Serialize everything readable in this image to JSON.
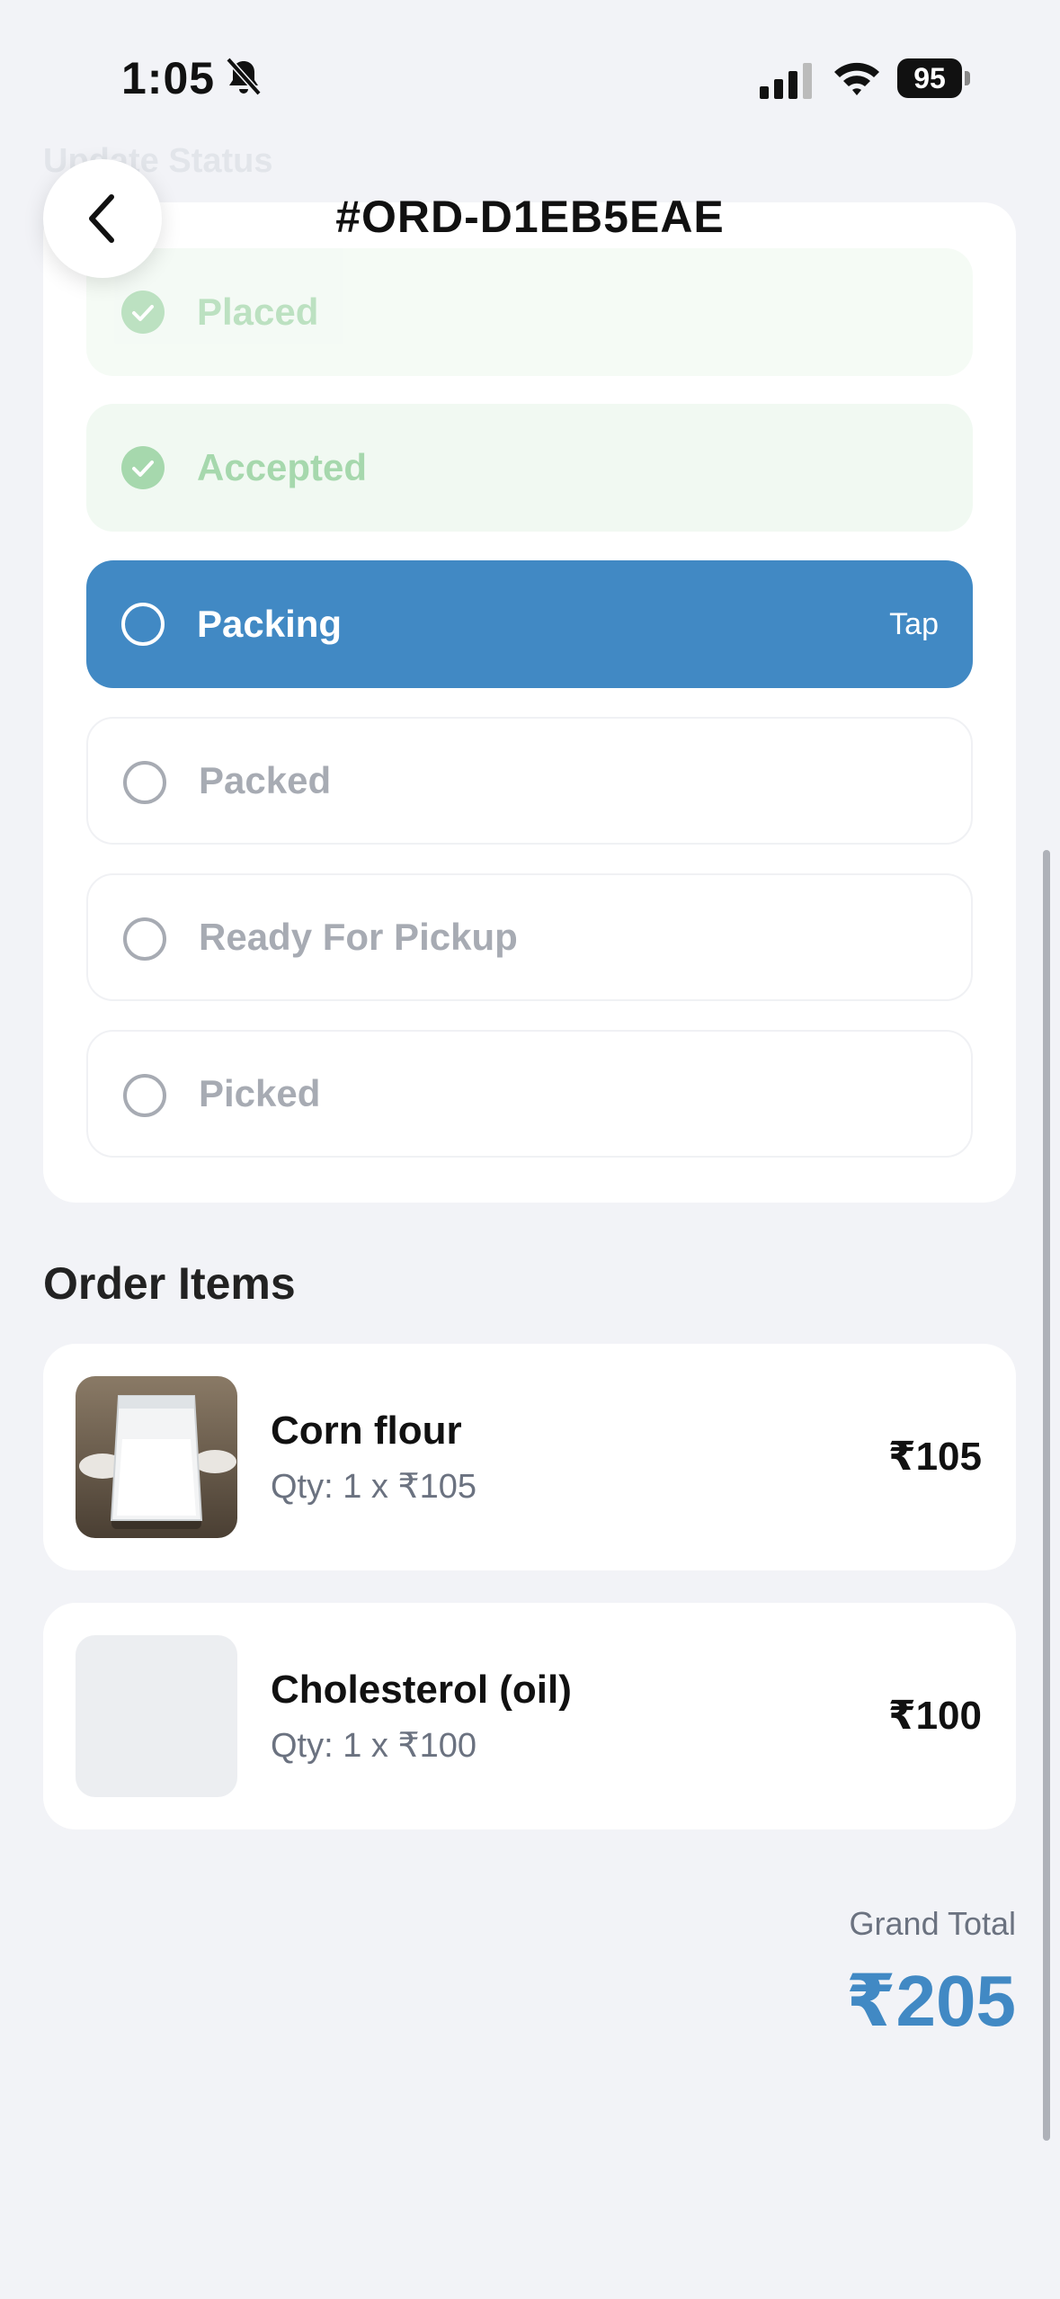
{
  "status_bar": {
    "time": "1:05",
    "battery": "95"
  },
  "faded_heading": "Update Status",
  "header": {
    "title": "#ORD-D1EB5EAE"
  },
  "statuses": [
    {
      "label": "Placed",
      "state": "done"
    },
    {
      "label": "Accepted",
      "state": "done"
    },
    {
      "label": "Packing",
      "state": "active",
      "hint": "Tap"
    },
    {
      "label": "Packed",
      "state": "pending"
    },
    {
      "label": "Ready For Pickup",
      "state": "pending"
    },
    {
      "label": "Picked",
      "state": "pending"
    }
  ],
  "order_items": {
    "title": "Order Items",
    "items": [
      {
        "name": "Corn flour",
        "qty": "Qty: 1 x ₹105",
        "price": "₹105",
        "thumb": "corn-flour-bag-image"
      },
      {
        "name": "Cholesterol (oil)",
        "qty": "Qty: 1 x ₹100",
        "price": "₹100",
        "thumb": "placeholder-image"
      }
    ]
  },
  "totals": {
    "label": "Grand Total",
    "value": "₹205"
  },
  "colors": {
    "accent": "#4189c4",
    "done_bg": "#f1f9f2",
    "done_check": "#a6d8ad",
    "page_bg": "#f2f3f7"
  },
  "icons": {
    "back": "chevron-left-icon",
    "bell": "bell-slash-icon",
    "done": "check-circle-icon",
    "pending": "empty-circle-icon"
  }
}
